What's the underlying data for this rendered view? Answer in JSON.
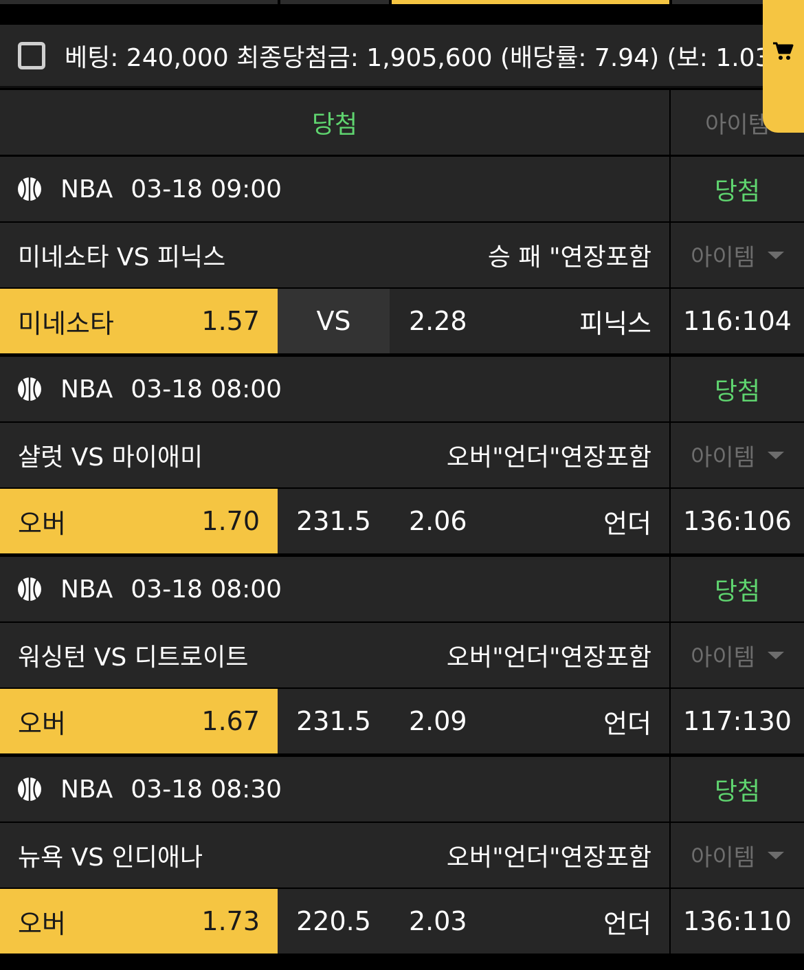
{
  "summary": {
    "text": "베팅: 240,000 최종당첨금: 1,905,600 (배당률: 7.94) (보: 1.03"
  },
  "header": {
    "result": "당첨",
    "item": "아이템"
  },
  "games": [
    {
      "league": "NBA",
      "datetime": "03-18 09:00",
      "result": "당첨",
      "match": "미네소타 VS 피닉스",
      "market": "승 패 \"연장포함",
      "item": "아이템",
      "pick_label": "미네소타",
      "pick_odds": "1.57",
      "middle": "VS",
      "other_odds": "2.28",
      "other_label": "피닉스",
      "score": "116:104"
    },
    {
      "league": "NBA",
      "datetime": "03-18 08:00",
      "result": "당첨",
      "match": "샬럿 VS 마이애미",
      "market": "오버\"언더\"연장포함",
      "item": "아이템",
      "pick_label": "오버",
      "pick_odds": "1.70",
      "middle": "231.5",
      "other_odds": "2.06",
      "other_label": "언더",
      "score": "136:106"
    },
    {
      "league": "NBA",
      "datetime": "03-18 08:00",
      "result": "당첨",
      "match": "워싱턴 VS 디트로이트",
      "market": "오버\"언더\"연장포함",
      "item": "아이템",
      "pick_label": "오버",
      "pick_odds": "1.67",
      "middle": "231.5",
      "other_odds": "2.09",
      "other_label": "언더",
      "score": "117:130"
    },
    {
      "league": "NBA",
      "datetime": "03-18 08:30",
      "result": "당첨",
      "match": "뉴욕 VS 인디애나",
      "market": "오버\"언더\"연장포함",
      "item": "아이템",
      "pick_label": "오버",
      "pick_odds": "1.73",
      "middle": "220.5",
      "other_odds": "2.03",
      "other_label": "언더",
      "score": "136:110"
    }
  ],
  "icons": {
    "sport": "basketball-icon",
    "cart": "cart-icon",
    "dropdown": "caret-down-icon"
  },
  "colors": {
    "accent": "#f5c542",
    "win": "#5fd46f",
    "row_bg": "#262626",
    "muted": "#6d6d6d"
  }
}
